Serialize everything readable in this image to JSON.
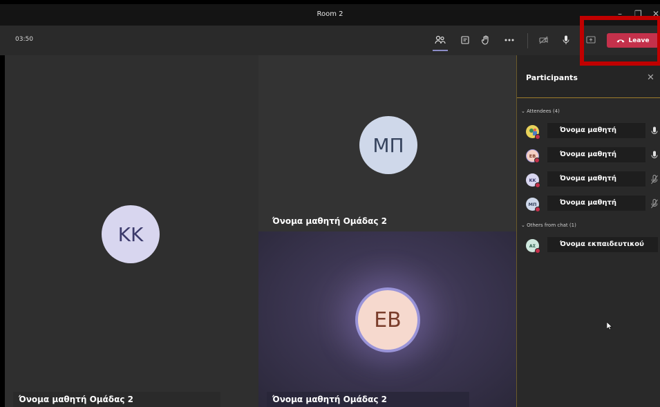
{
  "window": {
    "title": "Room 2",
    "minimize": "–",
    "maximize": "❐",
    "close": "✕"
  },
  "toolbar": {
    "timer": "03:50",
    "leave_label": "Leave",
    "buttons": [
      "people-icon",
      "chat-icon",
      "raise-hand-icon",
      "more-options-icon",
      "camera-off-icon",
      "mic-icon",
      "share-screen-icon"
    ]
  },
  "tiles": [
    {
      "initials": "KK",
      "name": "Όνομα μαθητή Ομάδας 2"
    },
    {
      "initials": "ΜΠ",
      "name": "Όνομα μαθητή Ομάδας 2"
    },
    {
      "initials": "EB",
      "name": "Όνομα μαθητή Ομάδας 2"
    }
  ],
  "panel": {
    "title": "Participants",
    "attendees_label": "Attendees (4)",
    "others_label": "Others from chat (1)",
    "attendees": [
      {
        "initials": "",
        "name": "Όνομα μαθητή",
        "mic": "on"
      },
      {
        "initials": "EB",
        "name": "Όνομα μαθητή",
        "mic": "on"
      },
      {
        "initials": "KK",
        "name": "Όνομα μαθητή",
        "mic": "muted"
      },
      {
        "initials": "ΜΠ",
        "name": "Όνομα μαθητή",
        "mic": "muted"
      }
    ],
    "others": [
      {
        "initials": "ΑΣ",
        "name": "Όνομα εκπαιδευτικού"
      }
    ]
  },
  "colors": {
    "leave": "#c4314b",
    "highlight": "#c00000",
    "accent": "#8b8cc7"
  }
}
